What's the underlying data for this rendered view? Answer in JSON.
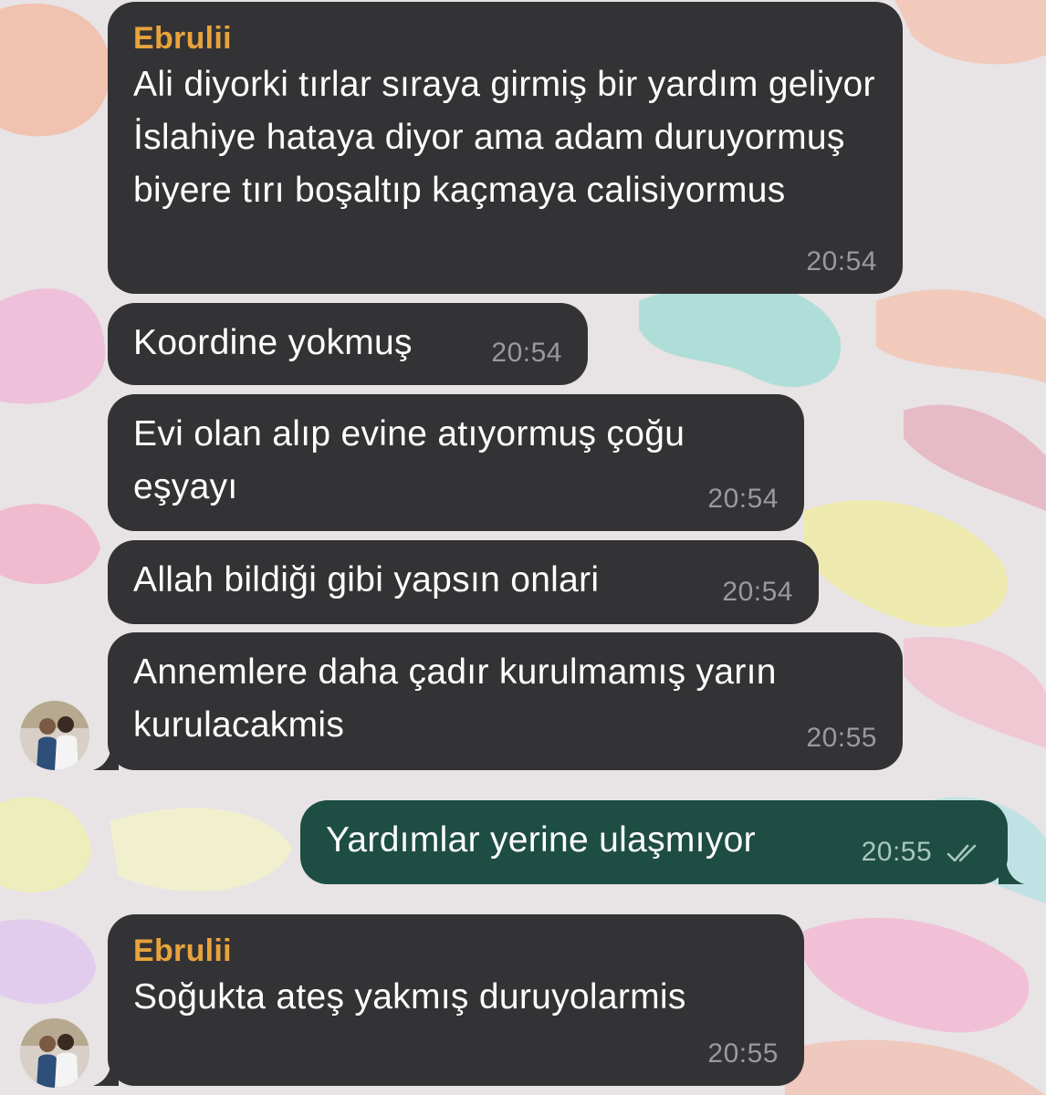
{
  "chat": {
    "messages": [
      {
        "sender": "Ebrulii",
        "text": "Ali diyorki tırlar sıraya girmiş bir yardım geliyor İslahiye hataya diyor ama adam duruyormuş biyere tırı boşaltıp kaçmaya calisiyormus",
        "time": "20:54"
      },
      {
        "text": "Koordine yokmuş",
        "time": "20:54"
      },
      {
        "text": "Evi olan alıp evine atıyormuş çoğu eşyayı",
        "time": "20:54"
      },
      {
        "text": "Allah bildiği gibi yapsın onlari",
        "time": "20:54"
      },
      {
        "text": "Annemlere daha çadır kurulmamış yarın kurulacakmis",
        "time": "20:55"
      },
      {
        "text": "Yardımlar yerine ulaşmıyor",
        "time": "20:55",
        "status_icon": "double-check-icon"
      },
      {
        "sender": "Ebrulii",
        "text": "Soğukta ateş yakmış duruyolarmis",
        "time": "20:55"
      }
    ]
  },
  "colors": {
    "incoming_bubble": "#333335",
    "outgoing_bubble": "#1e4d43",
    "sender_name": "#e8a33d",
    "timestamp": "#9a9a9c"
  }
}
